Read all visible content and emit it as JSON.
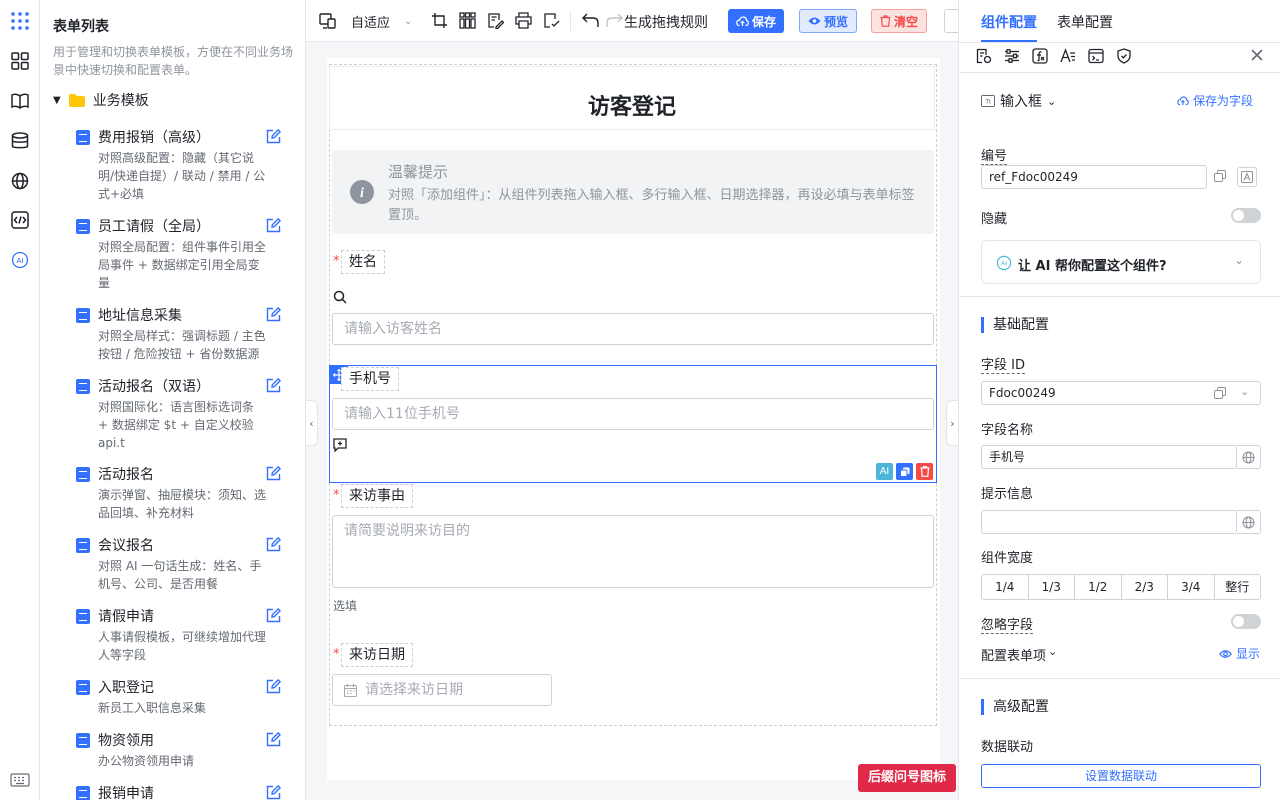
{
  "left_panel": {
    "title": "表单列表",
    "description": "用于管理和切换表单模板，方便在不同业务场景中快速切换和配置表单。",
    "folder": "业务模板",
    "templates": [
      {
        "name": "费用报销（高级）",
        "desc": "对照高级配置：隐藏（其它说明/快递自提）/ 联动 / 禁用 / 公式+必填"
      },
      {
        "name": "员工请假（全局）",
        "desc": "对照全局配置：组件事件引用全局事件 + 数据绑定引用全局变量"
      },
      {
        "name": "地址信息采集",
        "desc": "对照全局样式：强调标题 / 主色按钮 / 危险按钮 + 省份数据源"
      },
      {
        "name": "活动报名（双语）",
        "desc": "对照国际化：语言图标选词条 + 数据绑定 $t + 自定义校验 api.t"
      },
      {
        "name": "活动报名",
        "desc": "演示弹窗、抽屉模块：须知、选品回填、补充材料"
      },
      {
        "name": "会议报名",
        "desc": "对照 AI 一句话生成：姓名、手机号、公司、是否用餐"
      },
      {
        "name": "请假申请",
        "desc": "人事请假模板，可继续增加代理人等字段"
      },
      {
        "name": "入职登记",
        "desc": "新员工入职信息采集"
      },
      {
        "name": "物资领用",
        "desc": "办公物资领用申请"
      },
      {
        "name": "报销申请",
        "desc": ""
      }
    ]
  },
  "toolbar": {
    "layout": "自适应",
    "rule_label": "生成拖拽规则",
    "save": "保存",
    "preview": "预览",
    "clear": "清空"
  },
  "form": {
    "title": "访客登记",
    "tip_title": "温馨提示",
    "tip_text": "对照「添加组件」：从组件列表拖入输入框、多行输入框、日期选择器，再设必填与表单标签置顶。",
    "name_label": "姓名",
    "name_placeholder": "请输入访客姓名",
    "phone_label": "手机号",
    "phone_placeholder": "请输入11位手机号",
    "reason_label": "来访事由",
    "reason_placeholder": "请简要说明来访目的",
    "reason_hint": "选填",
    "date_label": "来访日期",
    "date_placeholder": "请选择来访日期",
    "float_button": "后缀问号图标"
  },
  "right_panel": {
    "tabs": [
      "组件配置",
      "表单配置"
    ],
    "component_type": "输入框",
    "save_as_field": "保存为字段",
    "id_label": "编号",
    "id_value": "ref_Fdoc00249",
    "hidden_label": "隐藏",
    "ai_prompt": "让 AI 帮你配置这个组件?",
    "basic_section": "基础配置",
    "field_id_label": "字段 ID",
    "field_id_value": "Fdoc00249",
    "field_name_label": "字段名称",
    "field_name_value": "手机号",
    "hint_label": "提示信息",
    "width_label": "组件宽度",
    "widths": [
      "1/4",
      "1/3",
      "1/2",
      "2/3",
      "3/4",
      "整行"
    ],
    "ignore_label": "忽略字段",
    "config_items_label": "配置表单项",
    "show_label": "显示",
    "advanced_section": "高级配置",
    "linkage_label": "数据联动",
    "linkage_button": "设置数据联动"
  },
  "colors": {
    "primary": "#3370ff",
    "danger": "#f54a45",
    "float_button": "#e02849"
  }
}
